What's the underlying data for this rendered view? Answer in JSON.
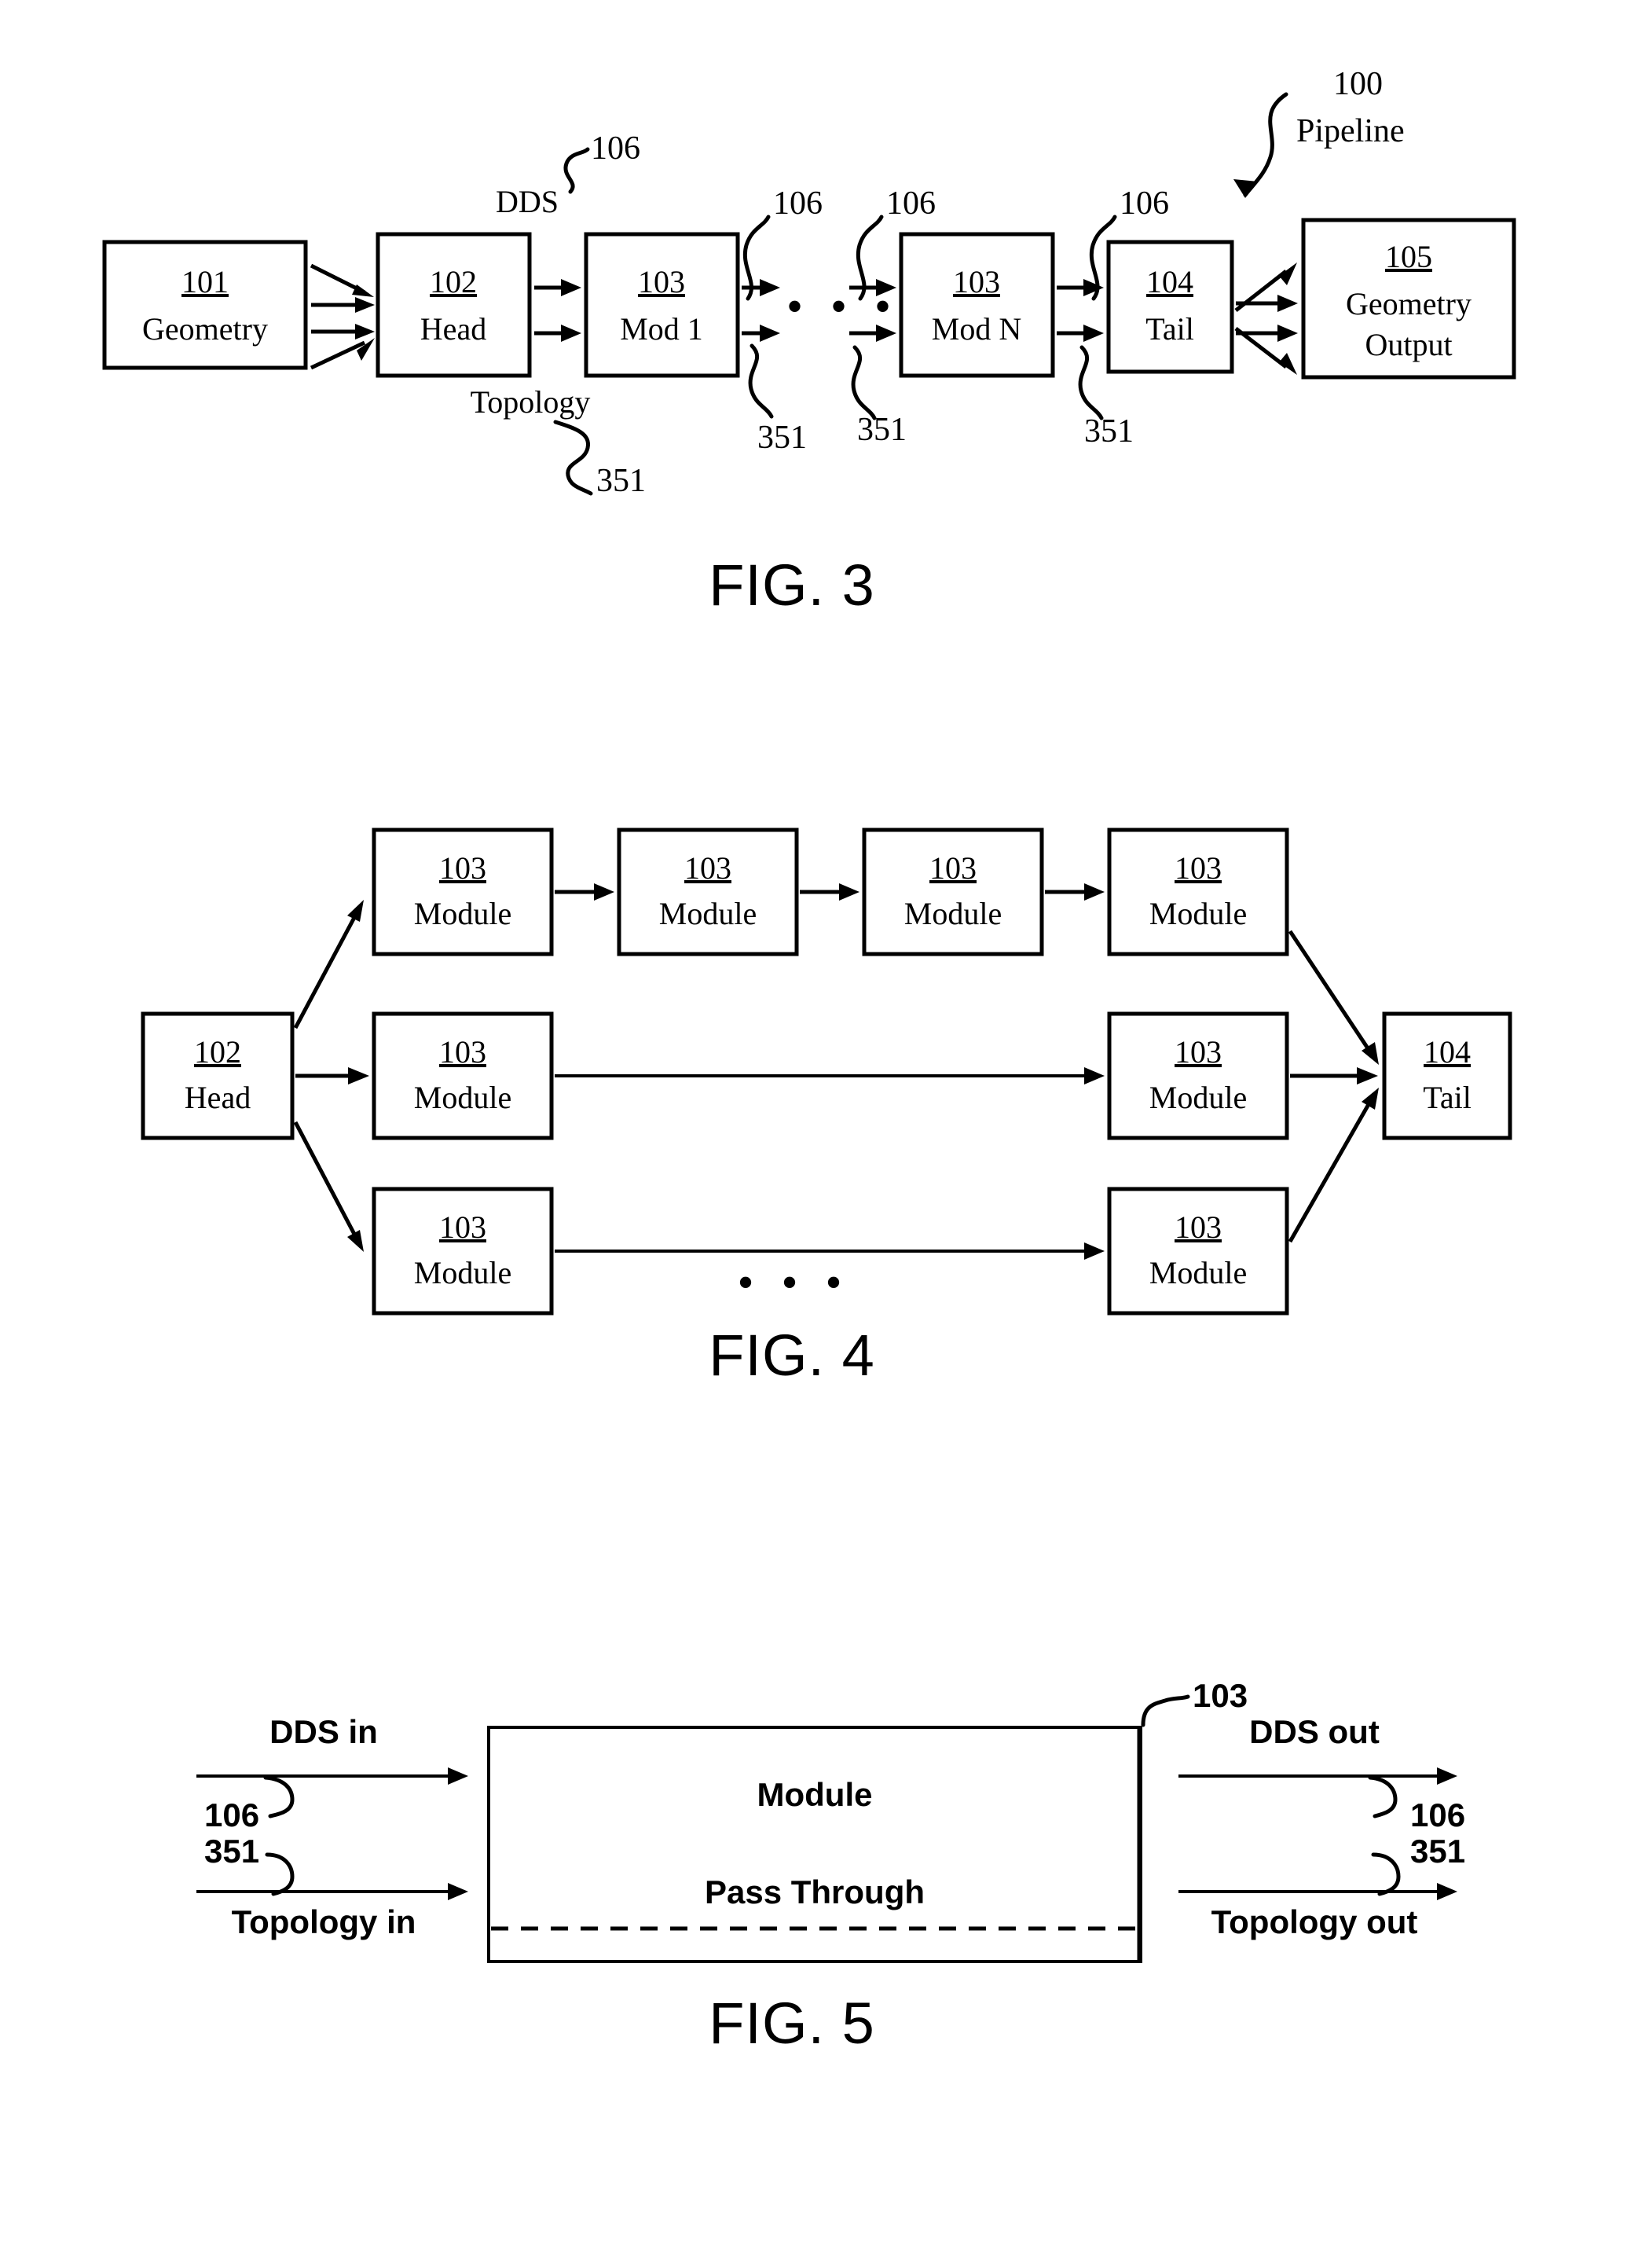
{
  "page": {
    "figures": [
      {
        "id": "fig3",
        "title": "FIG. 3",
        "boxes": [
          {
            "num": "101",
            "label": "Geometry"
          },
          {
            "num": "102",
            "label": "Head"
          },
          {
            "num": "103",
            "label": "Mod 1"
          },
          {
            "num": "103",
            "label": "Mod N"
          },
          {
            "num": "104",
            "label": "Tail"
          },
          {
            "num": "105",
            "label_line1": "Geometry",
            "label_line2": "Output"
          }
        ],
        "callouts": {
          "pipeline_num": "100",
          "pipeline_label": "Pipeline",
          "dds_label": "DDS",
          "topology_label": "Topology",
          "dds_refs": [
            "106",
            "106",
            "106",
            "106"
          ],
          "topology_refs": [
            "351",
            "351",
            "351",
            "351"
          ]
        },
        "ellipsis": "• • • •"
      },
      {
        "id": "fig4",
        "title": "FIG. 4",
        "head": {
          "num": "102",
          "label": "Head"
        },
        "tail": {
          "num": "104",
          "label": "Tail"
        },
        "rows": [
          [
            {
              "num": "103",
              "label": "Module"
            },
            {
              "num": "103",
              "label": "Module"
            },
            {
              "num": "103",
              "label": "Module"
            },
            {
              "num": "103",
              "label": "Module"
            }
          ],
          [
            {
              "num": "103",
              "label": "Module"
            },
            {
              "num": "103",
              "label": "Module"
            }
          ],
          [
            {
              "num": "103",
              "label": "Module"
            },
            {
              "num": "103",
              "label": "Module"
            }
          ]
        ],
        "ellipsis": "• • •"
      },
      {
        "id": "fig5",
        "title": "FIG. 5",
        "module_ref": "103",
        "module_label": "Module",
        "pass_through_label": "Pass Through",
        "inputs": [
          {
            "label": "DDS in",
            "ref": "106"
          },
          {
            "label": "Topology in",
            "ref": "351"
          }
        ],
        "outputs": [
          {
            "label": "DDS out",
            "ref": "106"
          },
          {
            "label": "Topology out",
            "ref": "351"
          }
        ]
      }
    ]
  },
  "colors": {
    "ink": "#000000",
    "paper": "#ffffff"
  }
}
